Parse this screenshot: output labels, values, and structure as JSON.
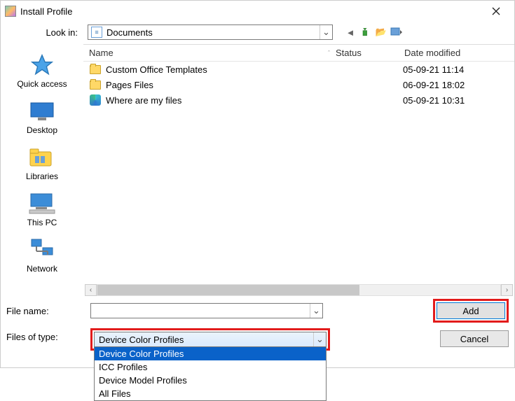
{
  "titlebar": {
    "title": "Install Profile"
  },
  "lookin": {
    "label": "Look in:",
    "selected": "Documents"
  },
  "columns": {
    "name": "Name",
    "status": "Status",
    "date": "Date modified"
  },
  "files": [
    {
      "icon": "folder",
      "name": "Custom Office Templates",
      "status": "",
      "date": "05-09-21 11:14"
    },
    {
      "icon": "folder",
      "name": "Pages Files",
      "status": "",
      "date": "06-09-21 18:02"
    },
    {
      "icon": "edge",
      "name": "Where are my files",
      "status": "",
      "date": "05-09-21 10:31"
    }
  ],
  "places": {
    "quick": "Quick access",
    "desktop": "Desktop",
    "libraries": "Libraries",
    "thispc": "This PC",
    "network": "Network"
  },
  "filename": {
    "label": "File name:",
    "value": ""
  },
  "filetype": {
    "label": "Files of type:",
    "selected": "Device Color Profiles",
    "options": [
      "Device Color Profiles",
      "ICC Profiles",
      "Device Model Profiles",
      "All Files"
    ]
  },
  "buttons": {
    "add": "Add",
    "cancel": "Cancel"
  }
}
